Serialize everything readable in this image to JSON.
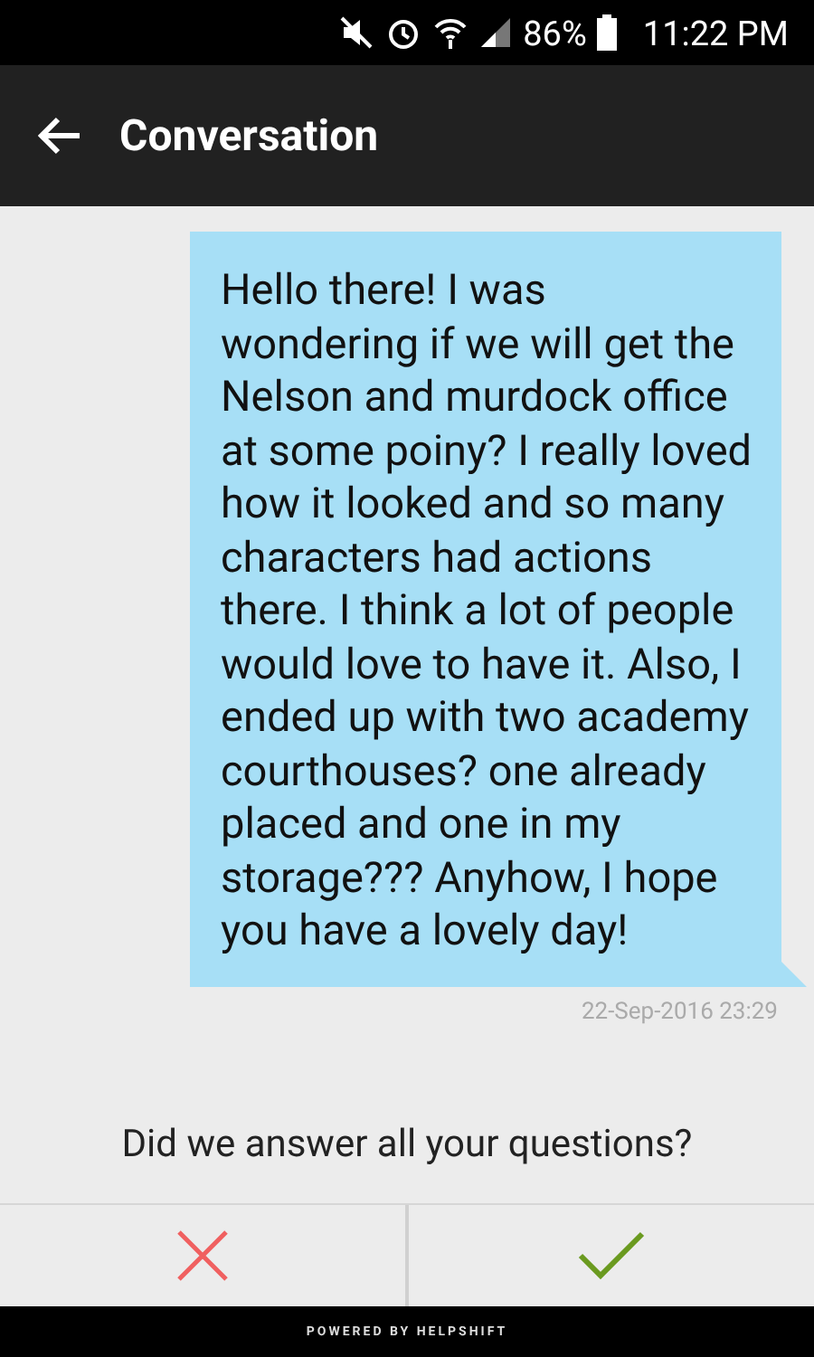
{
  "status_bar": {
    "battery": "86%",
    "time": "11:22 PM"
  },
  "app_bar": {
    "title": "Conversation"
  },
  "messages": [
    {
      "text": "Hello there! I was wondering if we will get the Nelson and murdock office at some poiny? I really loved how it looked and so many characters had actions there. I think a lot of people would love to have it. Also, I ended up with two academy courthouses? one already placed and one in my storage??? Anyhow, I hope you have a lovely day!",
      "timestamp": "22-Sep-2016 23:29"
    }
  ],
  "feedback": {
    "question": "Did we answer all your questions?"
  },
  "footer": "POWERED BY HELPSHIFT"
}
